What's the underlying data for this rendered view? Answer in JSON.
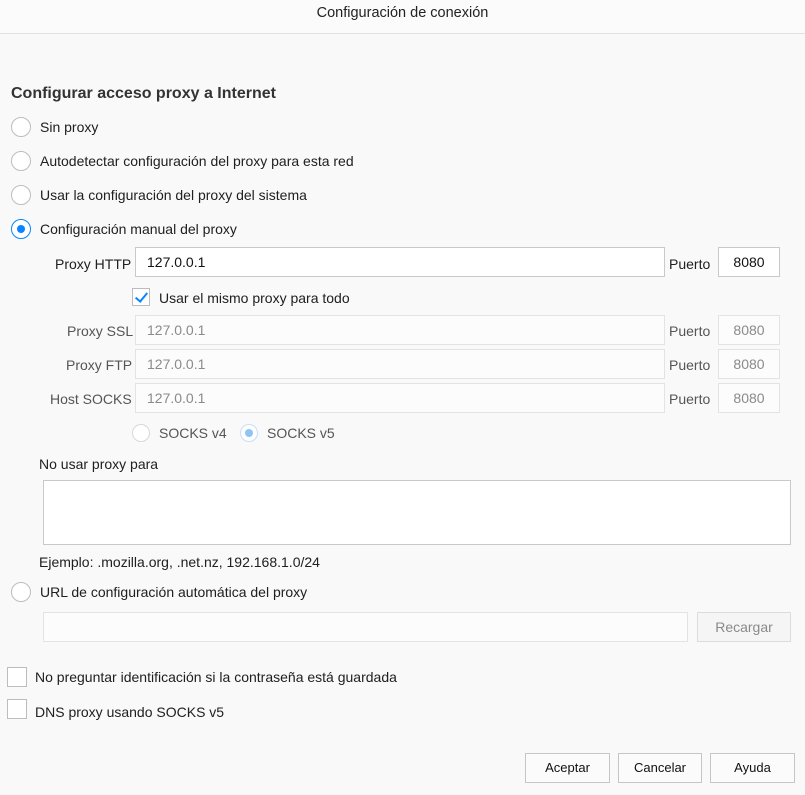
{
  "window": {
    "title": "Configuración de conexión"
  },
  "proxy": {
    "heading": "Configurar acceso proxy a Internet",
    "options": {
      "none": "Sin proxy",
      "autodetect": "Autodetectar configuración del proxy para esta red",
      "system": "Usar la configuración del proxy del sistema",
      "manual": "Configuración manual del proxy",
      "pac": "URL de configuración automática del proxy"
    },
    "selected": "manual",
    "http": {
      "label": "Proxy HTTP",
      "value": "127.0.0.1",
      "port_label": "Puerto",
      "port": "8080"
    },
    "same_for_all": {
      "label": "Usar el mismo proxy para todo",
      "checked": true
    },
    "ssl": {
      "label": "Proxy SSL",
      "value": "127.0.0.1",
      "port_label": "Puerto",
      "port": "8080"
    },
    "ftp": {
      "label": "Proxy FTP",
      "value": "127.0.0.1",
      "port_label": "Puerto",
      "port": "8080"
    },
    "socks": {
      "label": "Host SOCKS",
      "value": "127.0.0.1",
      "port_label": "Puerto",
      "port": "8080"
    },
    "socks_version": {
      "v4": "SOCKS v4",
      "v5": "SOCKS v5",
      "selected": "v5"
    },
    "no_proxy": {
      "label": "No usar proxy para",
      "value": "",
      "example": "Ejemplo: .mozilla.org, .net.nz, 192.168.1.0/24"
    },
    "pac": {
      "value": "",
      "reload_label": "Recargar"
    }
  },
  "options": {
    "no_prompt_auth": {
      "label": "No preguntar identificación si la contraseña está guardada",
      "checked": false
    },
    "dns_socks": {
      "label": "DNS proxy usando SOCKS v5",
      "checked": false
    }
  },
  "buttons": {
    "accept": "Aceptar",
    "cancel": "Cancelar",
    "help": "Ayuda"
  }
}
